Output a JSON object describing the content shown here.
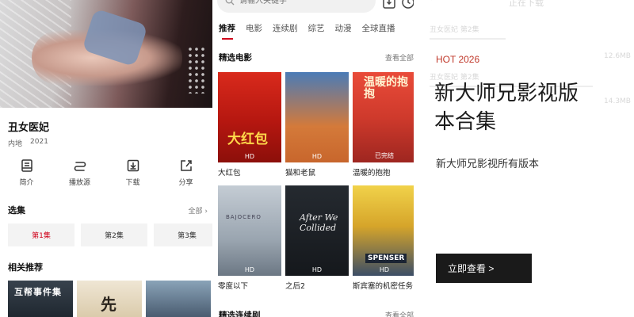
{
  "detail": {
    "title": "丑女医妃",
    "region": "内地",
    "year": "2021",
    "actions": [
      {
        "label": "简介",
        "icon": "intro-icon"
      },
      {
        "label": "播放源",
        "icon": "source-switch-icon"
      },
      {
        "label": "下载",
        "icon": "download-icon"
      },
      {
        "label": "分享",
        "icon": "share-icon"
      }
    ],
    "episodes_title": "选集",
    "episodes_more": "全部 ›",
    "episodes": [
      "第1集",
      "第2集",
      "第3集"
    ],
    "related_title": "相关推荐",
    "related": [
      {
        "text": "互帮事件集"
      },
      {
        "text": "先"
      },
      {
        "text": ""
      }
    ]
  },
  "home": {
    "search_placeholder": "请输入关键字",
    "tabs": [
      "推荐",
      "电影",
      "连续剧",
      "综艺",
      "动漫",
      "全球直播"
    ],
    "active_tab": "推荐",
    "section_movies": "精选电影",
    "section_more": "查看全部",
    "movies": [
      {
        "title": "大红包",
        "poster_text": "大红包",
        "badge": "HD"
      },
      {
        "title": "猫和老鼠",
        "poster_text": "",
        "badge": "HD"
      },
      {
        "title": "温暖的抱抱",
        "poster_text": "温暖的抱抱",
        "badge": "已完结"
      },
      {
        "title": "零度以下",
        "poster_text": "BAJOCERO",
        "badge": "HD"
      },
      {
        "title": "之后2",
        "poster_text": "After We Collided",
        "badge": "HD"
      },
      {
        "title": "斯宾塞的机密任务",
        "poster_text": "SPENSER",
        "badge": "HD"
      }
    ],
    "section_series": "精选连续剧",
    "section_series_more": "查看全部"
  },
  "promo": {
    "ghost_header": "正在下载",
    "ghost_item": "丑女医妃 第2集",
    "ghost_sizes": [
      "12.6MB",
      "14.3MB"
    ],
    "tag": "HOT 2026",
    "headline": "新大师兄影视版本合集",
    "description": "新大师兄影视所有版本",
    "button": "立即查看 >"
  },
  "colors": {
    "accent_red": "#d0021b",
    "button_dark": "#1a1a1a",
    "tag_red": "#c0392b"
  }
}
